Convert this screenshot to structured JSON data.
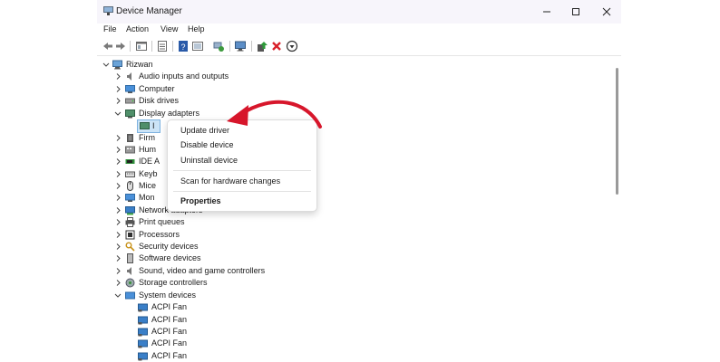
{
  "window": {
    "title": "Device Manager"
  },
  "menu": [
    "File",
    "Action",
    "View",
    "Help"
  ],
  "toolbar_icons": [
    "back-arrow-icon",
    "forward-arrow-icon",
    "properties-icon",
    "show-hidden-icon",
    "help-icon",
    "scan-icon",
    "monitor-icon",
    "update-driver-icon",
    "uninstall-icon",
    "disable-icon"
  ],
  "tree": {
    "root": "Rizwan",
    "items": [
      {
        "label": "Audio inputs and outputs",
        "icon": "speaker-icon",
        "expanded": false
      },
      {
        "label": "Computer",
        "icon": "computer-icon",
        "expanded": false
      },
      {
        "label": "Disk drives",
        "icon": "disk-icon",
        "expanded": false
      },
      {
        "label": "Display adapters",
        "icon": "display-icon",
        "expanded": true
      },
      {
        "label": "I",
        "icon": "display-adapter-icon",
        "child": true,
        "selected": true
      },
      {
        "label": "Firm",
        "icon": "firmware-icon",
        "expanded": false
      },
      {
        "label": "Hum",
        "icon": "hid-icon",
        "expanded": false
      },
      {
        "label": "IDE A",
        "icon": "ide-icon",
        "expanded": false
      },
      {
        "label": "Keyb",
        "icon": "keyboard-icon",
        "expanded": false
      },
      {
        "label": "Mice",
        "icon": "mouse-icon",
        "expanded": false
      },
      {
        "label": "Mon",
        "icon": "monitor-icon",
        "expanded": false
      },
      {
        "label": "Network adapters",
        "icon": "network-icon",
        "expanded": false
      },
      {
        "label": "Print queues",
        "icon": "printer-icon",
        "expanded": false
      },
      {
        "label": "Processors",
        "icon": "processor-icon",
        "expanded": false
      },
      {
        "label": "Security devices",
        "icon": "security-icon",
        "expanded": false
      },
      {
        "label": "Software devices",
        "icon": "software-icon",
        "expanded": false
      },
      {
        "label": "Sound, video and game controllers",
        "icon": "sound-icon",
        "expanded": false
      },
      {
        "label": "Storage controllers",
        "icon": "storage-icon",
        "expanded": false
      },
      {
        "label": "System devices",
        "icon": "system-icon",
        "expanded": true
      },
      {
        "label": "ACPI Fan",
        "icon": "system-device-icon",
        "child": true
      },
      {
        "label": "ACPI Fan",
        "icon": "system-device-icon",
        "child": true
      },
      {
        "label": "ACPI Fan",
        "icon": "system-device-icon",
        "child": true
      },
      {
        "label": "ACPI Fan",
        "icon": "system-device-icon",
        "child": true
      },
      {
        "label": "ACPI Fan",
        "icon": "system-device-icon",
        "child": true
      }
    ]
  },
  "context_menu": {
    "items": [
      "Update driver",
      "Disable device",
      "Uninstall device",
      "Scan for hardware changes",
      "Properties"
    ]
  },
  "colors": {
    "arrow": "#d7162b",
    "selection": "#cce4f7",
    "titlebar": "#f7f5fb"
  }
}
